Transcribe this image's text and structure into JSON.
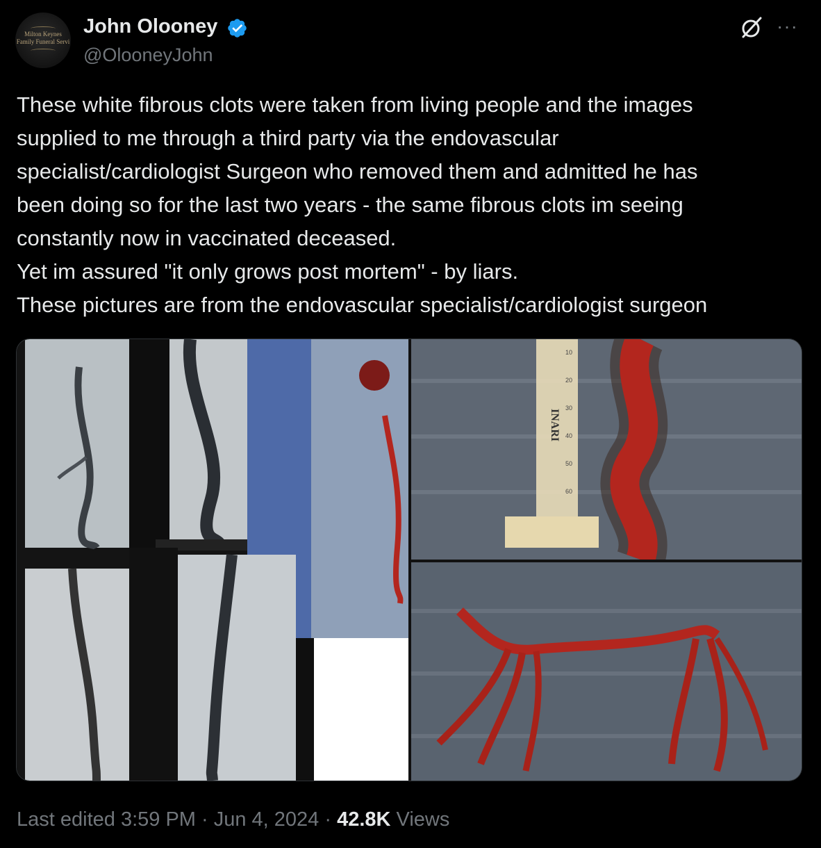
{
  "author": {
    "name": "John Olooney",
    "handle": "@OlooneyJohn",
    "avatar_text_line1": "Milton Keynes",
    "avatar_text_line2": "Family Funeral Servi"
  },
  "tweet": {
    "text": "These white fibrous clots were taken from living people and the images\nsupplied to me through a third party via the endovascular\nspecialist/cardiologist Surgeon who removed them and admitted he has\nbeen doing so for the last two years - the same fibrous clots im seeing\nconstantly now in vaccinated deceased.\nYet im assured \"it only grows post mortem\" - by liars.\nThese pictures are from the endovascular specialist/cardiologist surgeon"
  },
  "media": {
    "syringe_brand": "INARI",
    "syringe_ticks": [
      "10",
      "20",
      "30",
      "40",
      "50",
      "60"
    ]
  },
  "footer": {
    "edited": "Last edited 3:59 PM · Jun 4, 2024 · ",
    "views_count": "42.8K",
    "views_label": " Views"
  },
  "colors": {
    "background": "#000000",
    "text": "#e7e9ea",
    "muted": "#71767b",
    "verified": "#1d9bf0",
    "clot": "#b3261e"
  },
  "icons": [
    "verified-badge-icon",
    "grok-icon",
    "more-icon"
  ]
}
